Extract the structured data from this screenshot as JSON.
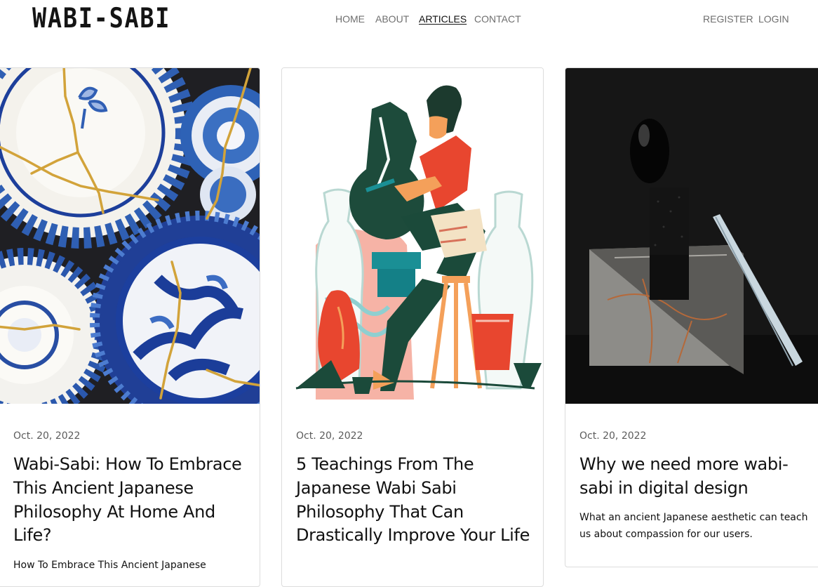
{
  "site": {
    "logo": "WABI-SABI",
    "nav": [
      "HOME",
      "ABOUT",
      "ARTICLES",
      "CONTACT"
    ],
    "active_nav": "ARTICLES",
    "auth": [
      "REGISTER",
      "LOGIN"
    ]
  },
  "articles": [
    {
      "image": "kintsugi-blue-white-plates-photo",
      "date": "Oct. 20, 2022",
      "title": "Wabi-Sabi:  How To Embrace This Ancient Japanese  Philosophy At Home And  Life?",
      "excerpt": "How To  Embrace This Ancient Japanese"
    },
    {
      "image": "potter-illustration",
      "date": "Oct. 20, 2022",
      "title": "5 Teachings  From The Japanese Wabi Sabi Philosophy That Can Drastically  Improve Your Life"
    },
    {
      "image": "dark-still-life-photo",
      "date": "Oct. 20, 2022",
      "title": "Why we need more wabi-sabi in digital design",
      "excerpt": "What an ancient Japanese aesthetic can teach us about compassion for our users."
    }
  ],
  "colors": {
    "nav_text": "#6f6f6f",
    "active_nav": "#111111",
    "card_border": "#dcdcdc",
    "porcelain_blue": "#1c3f9e",
    "kintsugi_gold": "#d2a33a",
    "illustration_red": "#e8462f",
    "illustration_green": "#1b4a3a",
    "dark_photo": "#161616"
  }
}
